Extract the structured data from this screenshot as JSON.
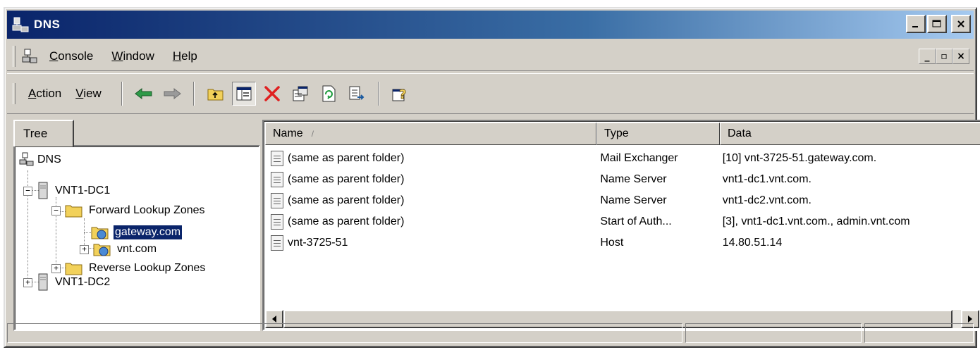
{
  "window": {
    "title": "DNS"
  },
  "menu": {
    "items": [
      {
        "underline": "C",
        "rest": "onsole"
      },
      {
        "underline": "W",
        "rest": "indow"
      },
      {
        "underline": "H",
        "rest": "elp"
      }
    ],
    "mdi": {
      "minimize": "_",
      "restore": "▫",
      "close": "×"
    }
  },
  "toolbar": {
    "action": {
      "underline": "A",
      "rest": "ction"
    },
    "view": {
      "underline": "V",
      "rest": "iew"
    }
  },
  "tree": {
    "tab_label": "Tree",
    "nodes": [
      {
        "label": "DNS"
      },
      {
        "label": "VNT1-DC1"
      },
      {
        "label": "Forward Lookup Zones"
      },
      {
        "label": "gateway.com"
      },
      {
        "label": "vnt.com"
      },
      {
        "label": "Reverse Lookup Zones"
      },
      {
        "label": "VNT1-DC2"
      }
    ]
  },
  "list": {
    "columns": [
      "Name",
      "Type",
      "Data"
    ],
    "sort_indicator": "/",
    "rows": [
      {
        "name": "(same as parent folder)",
        "type": "Mail Exchanger",
        "data": "[10]  vnt-3725-51.gateway.com."
      },
      {
        "name": "(same as parent folder)",
        "type": "Name Server",
        "data": "vnt1-dc1.vnt.com."
      },
      {
        "name": "(same as parent folder)",
        "type": "Name Server",
        "data": "vnt1-dc2.vnt.com."
      },
      {
        "name": "(same as parent folder)",
        "type": "Start of Auth...",
        "data": "[3], vnt1-dc1.vnt.com., admin.vnt.com"
      },
      {
        "name": "vnt-3725-51",
        "type": "Host",
        "data": "14.80.51.14"
      }
    ]
  },
  "colors": {
    "title_start": "#0a246a",
    "title_end": "#a6caf0",
    "face": "#d4d0c8",
    "selection": "#0a246a",
    "delete_red": "#e02020",
    "folder_yellow": "#f2d15a",
    "arrow_green": "#1a9a3a"
  }
}
